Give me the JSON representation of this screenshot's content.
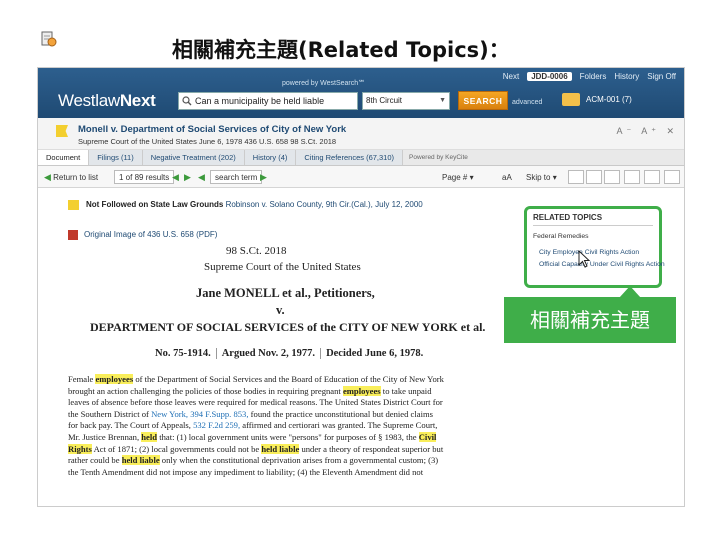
{
  "slide": {
    "title": "相關補充主題(Related Topics)："
  },
  "topbar": {
    "powered_by": "powered by WestSearch℠",
    "links": [
      "Next",
      "JDD-0006",
      "Folders",
      "History",
      "Sign Off"
    ],
    "logo_main": "Westlaw",
    "logo_next": "Next",
    "search_value": "Can a municipality be held liable",
    "jurisdiction": "8th Circuit",
    "search_button": "SEARCH",
    "advanced": "advanced",
    "folder_label": "ACM-001 (7)"
  },
  "document": {
    "title": "Monell v. Department of Social Services of City of New York",
    "citation": "Supreme Court of the United States   June 6, 1978   436 U.S. 658   98 S.Ct. 2018",
    "tools": "A⁻ A⁺ ✕"
  },
  "tabs": [
    {
      "label": "Document",
      "active": true
    },
    {
      "label": "Filings (11)",
      "active": false
    },
    {
      "label": "Negative Treatment (202)",
      "active": false
    },
    {
      "label": "History (4)",
      "active": false
    },
    {
      "label": "Citing References (67,310)",
      "active": false
    }
  ],
  "tabs_powered": "Powered by KeyCite",
  "toolbar": {
    "return_to_list": "Return to list",
    "results": "1 of 89 results",
    "search_term": "search term",
    "page_menu": "Page #",
    "text_size": "aA",
    "skip_to": "Skip to"
  },
  "content": {
    "negative_flag_label": "Not Followed on State Law Grounds",
    "negative_flag_case": "Robinson v. Solano County, 9th Cir.(Cal.), July 12, 2000",
    "original_image": "Original Image of 436 U.S. 658 (PDF)",
    "court_cite": "98 S.Ct. 2018",
    "court_name": "Supreme Court of the United States",
    "party1": "Jane MONELL et al., Petitioners,",
    "v": "v.",
    "party2": "DEPARTMENT OF SOCIAL SERVICES of the CITY OF NEW YORK et al.",
    "docket": "No. 75-1914.",
    "argued": "Argued Nov. 2, 1977.",
    "decided": "Decided June 6, 1978.",
    "syllabus": {
      "l1a": "Female ",
      "l1b": "employees",
      "l1c": " of the Department of Social Services and the Board of Education of the City of New York",
      "l2": "brought an action challenging the policies of those bodies in requiring pregnant ",
      "l2b": "employees",
      "l2c": " to take unpaid",
      "l3": "leaves of absence before those leaves were required for medical reasons. The United States District Court for",
      "l4a": "the Southern District of ",
      "l4b": "New York, 394 F.Supp. 853,",
      "l4c": " found the practice unconstitutional but denied claims",
      "l5a": "for back pay. The Court of Appeals, ",
      "l5b": "532 F.2d 259,",
      "l5c": " affirmed and certiorari was granted. The Supreme Court,",
      "l6a": "Mr. Justice Brennan, ",
      "l6b": "held",
      "l6c": " that: (1) local government units were \"persons\" for purposes of § 1983, the ",
      "l6d": "Civil",
      "l7a": "Rights",
      "l7b": " Act of 1871; (2) local governments could not be ",
      "l7c": "held liable",
      "l7d": " under a theory of respondeat superior but",
      "l8a": "rather could be ",
      "l8b": "held liable",
      "l8c": " only when the constitutional deprivation arises from a governmental custom; (3)",
      "l9": "the Tenth Amendment did not impose any impediment to liability; (4) the Eleventh Amendment did not"
    }
  },
  "related_topics": {
    "title": "RELATED TOPICS",
    "heading": "Federal Remedies",
    "items": [
      "City Employee Civil Rights Action",
      "Official Capacity Under Civil Rights Action"
    ]
  },
  "callout": {
    "label": "相關補充主題"
  },
  "colors": {
    "accent_green": "#3fae49",
    "topbar_blue": "#1f4a73",
    "highlight_yellow": "#f9ee5a",
    "search_orange": "#f5a623"
  }
}
